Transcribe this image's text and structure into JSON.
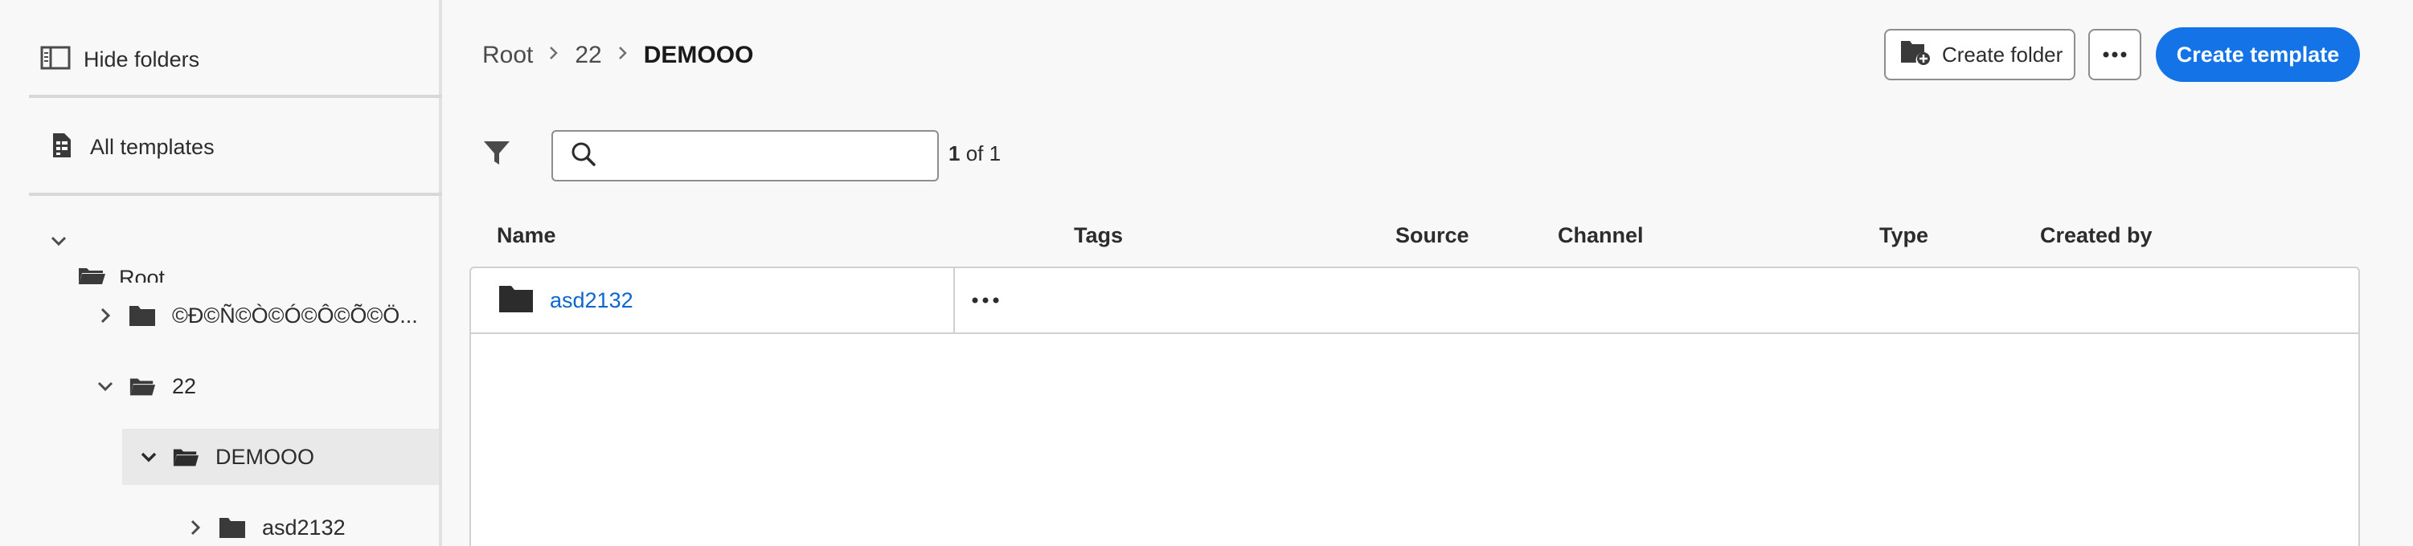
{
  "sidebar": {
    "hide_folders_label": "Hide folders",
    "all_templates_label": "All templates",
    "tree": {
      "root_label": "Root",
      "items": [
        {
          "label": "©Ð©Ñ©Ò©Ó©Ô©Õ©Ö...",
          "expanded": false
        },
        {
          "label": "22",
          "expanded": true
        },
        {
          "label": "DEMOOO",
          "expanded": true,
          "selected": true
        },
        {
          "label": "asd2132",
          "expanded": false
        }
      ]
    }
  },
  "breadcrumb": {
    "items": [
      "Root",
      "22"
    ],
    "current": "DEMOOO"
  },
  "toolbar": {
    "create_folder_label": "Create folder",
    "create_template_label": "Create template",
    "accent_color": "#1473e6"
  },
  "search": {
    "placeholder": "",
    "value": ""
  },
  "pagination": {
    "current": "1",
    "suffix": "of 1"
  },
  "table": {
    "columns": [
      "Name",
      "Tags",
      "Source",
      "Channel",
      "Type",
      "Created by"
    ],
    "rows": [
      {
        "name": "asd2132",
        "icon": "folder-icon"
      }
    ]
  }
}
